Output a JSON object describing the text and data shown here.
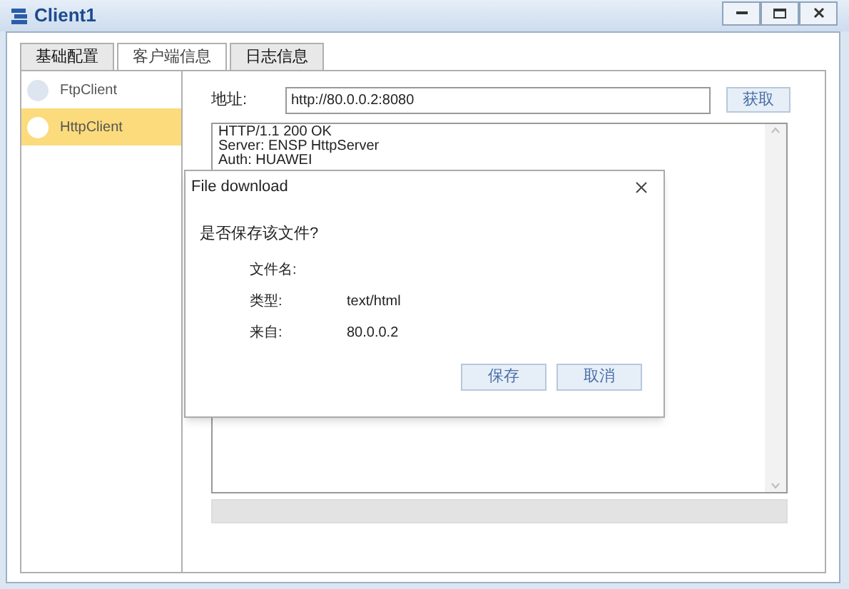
{
  "window": {
    "title": "Client1"
  },
  "tabs": [
    {
      "label": "基础配置",
      "selected": false
    },
    {
      "label": "客户端信息",
      "selected": true
    },
    {
      "label": "日志信息",
      "selected": false
    }
  ],
  "sidebar": {
    "items": [
      {
        "label": "FtpClient",
        "selected": false
      },
      {
        "label": "HttpClient",
        "selected": true
      }
    ]
  },
  "address": {
    "label": "地址:",
    "value": "http://80.0.0.2:8080"
  },
  "fetch_button": "获取",
  "response_lines": [
    "HTTP/1.1 200 OK",
    "Server: ENSP HttpServer",
    "Auth: HUAWEI"
  ],
  "dialog": {
    "title": "File download",
    "question": "是否保存该文件?",
    "fields": [
      {
        "label": "文件名:"
      },
      {
        "label": "类型:",
        "value": "text/html"
      },
      {
        "label": "来自:",
        "value": "80.0.0.2"
      }
    ],
    "buttons": [
      "保存",
      "取消"
    ]
  }
}
